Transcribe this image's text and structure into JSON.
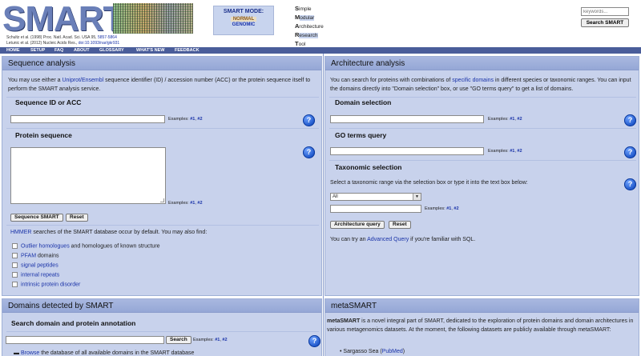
{
  "header": {
    "logo_text": "SMART",
    "citations": [
      {
        "text": "Schultz et al. (1998) Proc. Natl. Acad. Sci. USA 95, ",
        "link": "5857-5864"
      },
      {
        "text": "Letunic et al. (2012) Nucleic Acids Res., ",
        "link": "doi:10.1093/nar/gkr931"
      }
    ],
    "mode": {
      "title": "SMART MODE:",
      "normal": "NORMAL",
      "genomic": "GENOMIC"
    },
    "acronym": [
      {
        "letter": "S",
        "rest": "imple"
      },
      {
        "letter": "M",
        "rest": "odular"
      },
      {
        "letter": "A",
        "rest": "rchitecture"
      },
      {
        "letter": "R",
        "rest": "esearch"
      },
      {
        "letter": "T",
        "rest": "ool"
      }
    ],
    "search": {
      "placeholder": "keywords...",
      "button": "Search SMART"
    }
  },
  "nav": [
    "HOME",
    "SETUP",
    "FAQ",
    "ABOUT",
    "GLOSSARY",
    "WHAT'S NEW",
    "FEEDBACK"
  ],
  "sequence_analysis": {
    "title": "Sequence analysis",
    "desc_pre": "You may use either a ",
    "desc_link": "Uniprot/Ensembl",
    "desc_post": " sequence identifier (ID) / accession number (ACC) or the protein sequence itself to perform the SMART analysis service.",
    "id_section": "Sequence ID or ACC",
    "protein_section": "Protein sequence",
    "examples_label": "Examples:",
    "ex1": "#1",
    "ex2": "#2",
    "sequence_button": "Sequence SMART",
    "reset_button": "Reset",
    "hmmer_link": "HMMER",
    "hmmer_text": " searches of the SMART database occur by default. You may also find:",
    "options": [
      {
        "link": "Outlier homologues",
        "rest": " and homologues of known structure"
      },
      {
        "link": "PFAM",
        "rest": " domains"
      },
      {
        "link": "signal peptides",
        "rest": ""
      },
      {
        "link": "internal repeats",
        "rest": ""
      },
      {
        "link": "intrinsic protein disorder",
        "rest": ""
      }
    ]
  },
  "architecture_analysis": {
    "title": "Architecture analysis",
    "desc_pre": "You can search for proteins with combinations of ",
    "desc_link": "specific domains",
    "desc_post": " in different species or taxonomic ranges. You can input the domains directly into \"Domain selection\" box, or use \"GO terms query\" to get a list of domains.",
    "domain_section": "Domain selection",
    "go_section": "GO terms query",
    "tax_section": "Taxonomic selection",
    "tax_desc": "Select a taxonomic range via the selection box or type it into the text box below:",
    "tax_select_value": "All",
    "examples_label": "Examples:",
    "ex1": "#1",
    "ex2": "#2",
    "architecture_button": "Architecture query",
    "reset_button": "Reset",
    "advanced_pre": "You can try an ",
    "advanced_link": "Advanced Query",
    "advanced_post": " if you're familiar with SQL."
  },
  "domains_detected": {
    "title": "Domains detected by SMART",
    "search_section": "Search domain and protein annotation",
    "search_button": "Search",
    "examples_label": "Examples:",
    "ex1": "#1",
    "ex2": "#2",
    "browse_link": "Browse",
    "browse_text": " the database of all available domains in the SMART database"
  },
  "metasmart": {
    "title": "metaSMART",
    "desc_bold": "metaSMART",
    "desc_rest": " is a novel integral part of SMART, dedicated to the exploration of protein domains and domain architectures in various metagenomics datasets. At the moment, the following datasets are publicly available through metaSMART:",
    "datasets": [
      {
        "name": "Sargasso Sea (",
        "link": "PubMed",
        "close": ")"
      }
    ]
  },
  "help_icon_glyph": "?",
  "colors": {
    "panel_bg": "#c8d2ec",
    "panel_header": "#a9b8e0",
    "nav_bg": "#4a5d9a",
    "link": "#1a33a8",
    "help_icon": "#1c54c8"
  }
}
